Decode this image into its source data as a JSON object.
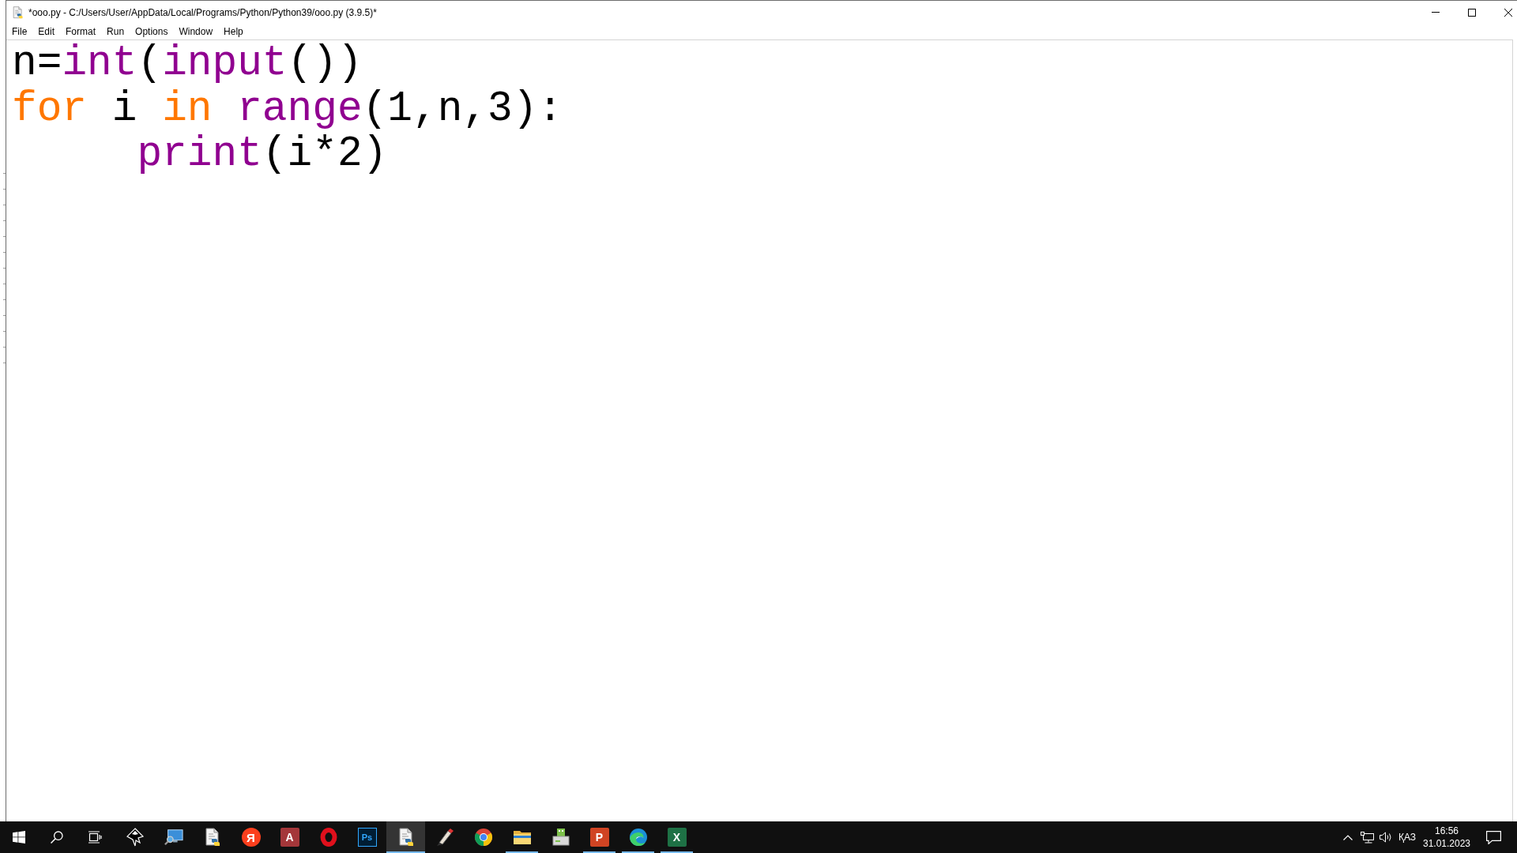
{
  "window": {
    "title": "*ooo.py - C:/Users/User/AppData/Local/Programs/Python/Python39/ooo.py (3.9.5)*"
  },
  "menu": [
    "File",
    "Edit",
    "Format",
    "Run",
    "Options",
    "Window",
    "Help"
  ],
  "editor": {
    "lines": [
      {
        "tokens": [
          {
            "kind": "plain",
            "text": "n="
          },
          {
            "kind": "builtin",
            "text": "int"
          },
          {
            "kind": "plain",
            "text": "("
          },
          {
            "kind": "builtin",
            "text": "input"
          },
          {
            "kind": "plain",
            "text": "())"
          }
        ]
      },
      {
        "tokens": [
          {
            "kind": "keyword",
            "text": "for"
          },
          {
            "kind": "plain",
            "text": " i "
          },
          {
            "kind": "keyword",
            "text": "in "
          },
          {
            "kind": "builtin",
            "text": "range"
          },
          {
            "kind": "plain",
            "text": "(1,n,3):"
          }
        ],
        "children": [
          {
            "tokens": [
              {
                "kind": "builtin",
                "text": "print"
              },
              {
                "kind": "plain",
                "text": "(i*2)"
              }
            ]
          }
        ]
      }
    ]
  },
  "taskbar": {
    "apps": [
      {
        "kind": "diamond",
        "running": false,
        "selected": false
      },
      {
        "kind": "monitor",
        "running": false,
        "selected": false
      },
      {
        "kind": "document",
        "running": false,
        "selected": false
      },
      {
        "kind": "circle_letter",
        "glyph": "Я",
        "running": false,
        "selected": false
      },
      {
        "kind": "database_letter",
        "glyph": "A",
        "running": false,
        "selected": false
      },
      {
        "kind": "ring",
        "running": false,
        "selected": false
      },
      {
        "kind": "square_letters",
        "glyph": "Ps",
        "running": false,
        "selected": false
      },
      {
        "kind": "document",
        "running": true,
        "selected": true
      },
      {
        "kind": "brush",
        "running": false,
        "selected": false
      },
      {
        "kind": "tricolor",
        "running": false,
        "selected": false
      },
      {
        "kind": "folder",
        "running": true,
        "selected": false
      },
      {
        "kind": "drive",
        "running": false,
        "selected": false
      },
      {
        "kind": "slides_letter",
        "glyph": "P",
        "running": true,
        "selected": false
      },
      {
        "kind": "swirl",
        "running": true,
        "selected": false
      },
      {
        "kind": "sheet_letter",
        "glyph": "X",
        "running": true,
        "selected": false
      }
    ],
    "tray": {
      "language": "ҚАЗ",
      "time": "16:56",
      "date": "31.01.2023"
    }
  }
}
